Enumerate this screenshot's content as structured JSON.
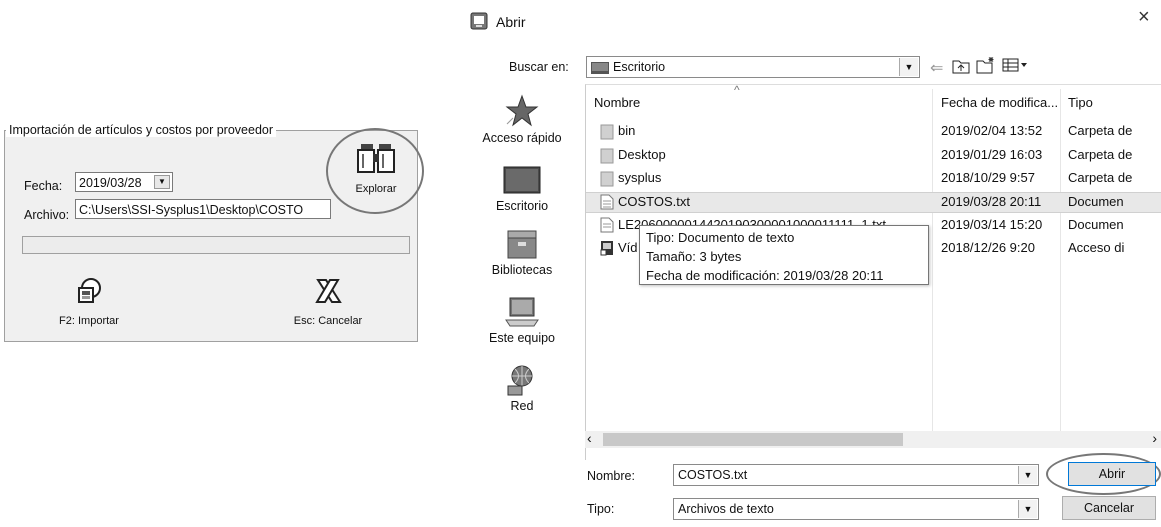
{
  "import_panel": {
    "group_title": "Importación de artículos y costos por proveedor",
    "fecha_label": "Fecha:",
    "fecha_value": "2019/03/28",
    "archivo_label": "Archivo:",
    "archivo_value": "C:\\Users\\SSI-Sysplus1\\Desktop\\COSTO",
    "explorar_label": "Explorar",
    "importar_label": "F2: Importar",
    "cancelar_label": "Esc: Cancelar"
  },
  "dialog": {
    "title": "Abrir",
    "close_glyph": "×",
    "buscar_label": "Buscar en:",
    "buscar_value": "Escritorio",
    "places": [
      {
        "label": "Acceso rápido",
        "icon": "star-icon"
      },
      {
        "label": "Escritorio",
        "icon": "desktop-icon"
      },
      {
        "label": "Bibliotecas",
        "icon": "library-icon"
      },
      {
        "label": "Este equipo",
        "icon": "computer-icon"
      },
      {
        "label": "Red",
        "icon": "network-icon"
      }
    ],
    "columns": {
      "name": "Nombre",
      "date": "Fecha de modifica...",
      "type": "Tipo"
    },
    "files": [
      {
        "name": "bin",
        "date": "2019/02/04 13:52",
        "type": "Carpeta de",
        "icon": "folder-icon"
      },
      {
        "name": "Desktop",
        "date": "2019/01/29 16:03",
        "type": "Carpeta de",
        "icon": "folder-icon"
      },
      {
        "name": "sysplus",
        "date": "2018/10/29 9:57",
        "type": "Carpeta de",
        "icon": "folder-icon"
      },
      {
        "name": "COSTOS.txt",
        "date": "2019/03/28 20:11",
        "type": "Documen",
        "icon": "text-file-icon",
        "selected": true
      },
      {
        "name": "LE2060000014420190300001000011111_1.txt",
        "date": "2019/03/14 15:20",
        "type": "Documen",
        "icon": "text-file-icon"
      },
      {
        "name": "Víd",
        "date": "2018/12/26 9:20",
        "type": "Acceso di",
        "icon": "video-shortcut-icon"
      }
    ],
    "tooltip": {
      "line1": "Tipo: Documento de texto",
      "line2": "Tamaño: 3 bytes",
      "line3": "Fecha de modificación: 2019/03/28 20:11"
    },
    "nombre_label": "Nombre:",
    "nombre_value": "COSTOS.txt",
    "tipo_label": "Tipo:",
    "tipo_value": "Archivos de texto",
    "abrir_button": "Abrir",
    "cancelar_button": "Cancelar"
  },
  "colors": {
    "highlight_circle": "#777777",
    "selected_row": "#e8e8e8"
  }
}
